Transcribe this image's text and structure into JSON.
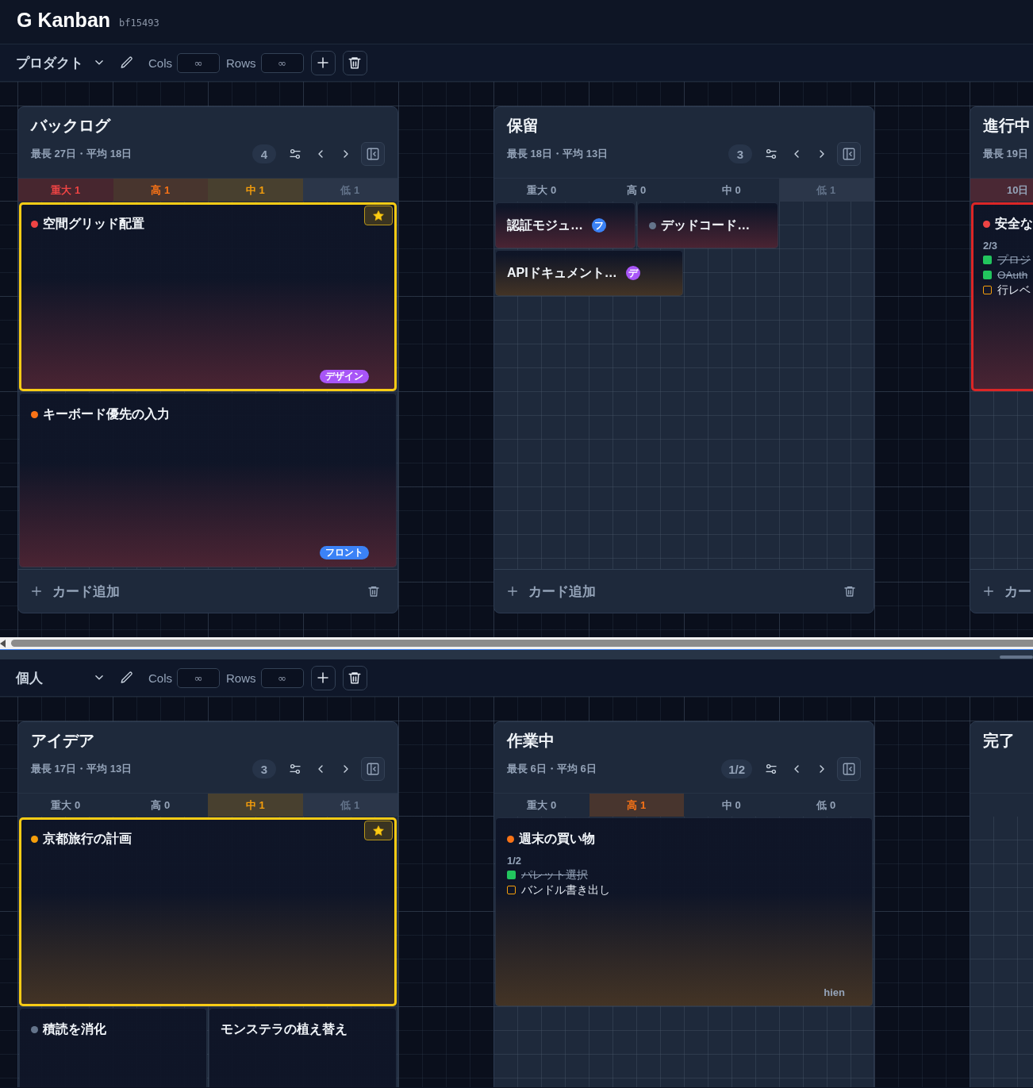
{
  "header": {
    "title": "G Kanban",
    "version": "bf15493"
  },
  "boards": [
    {
      "project": "プロダクト",
      "cols": {
        "label": "Cols",
        "placeholder": "∞"
      },
      "rows": {
        "label": "Rows",
        "placeholder": "∞"
      },
      "columns": [
        {
          "title": "バックログ",
          "stats": "最長 27日・平均 18日",
          "count": "4",
          "bands": [
            {
              "label": "重大 1",
              "kind": "critical",
              "active": true
            },
            {
              "label": "高 1",
              "kind": "high",
              "active": true
            },
            {
              "label": "中 1",
              "kind": "medium",
              "active": true
            },
            {
              "label": "低 1",
              "kind": "low",
              "active": true
            }
          ],
          "cards": [
            {
              "title": "空間グリッド配置",
              "color": "#ef4444",
              "kind": "red",
              "starred": true,
              "flagged": false,
              "tags": [
                {
                  "label": "デザイン",
                  "kind": "pill",
                  "color": "#a855f7"
                }
              ]
            },
            {
              "title": "キーボード優先の入力",
              "color": "#f97316",
              "kind": "red",
              "starred": false,
              "flagged": false,
              "tags": [
                {
                  "label": "フロント",
                  "kind": "pill",
                  "color": "#3b82f6"
                }
              ]
            }
          ],
          "footer": "カード追加"
        },
        {
          "title": "保留",
          "stats": "最長 18日・平均 13日",
          "count": "3",
          "bands": [
            {
              "label": "重大 0",
              "kind": "critical",
              "active": false
            },
            {
              "label": "高 0",
              "kind": "high",
              "active": false
            },
            {
              "label": "中 0",
              "kind": "medium",
              "active": false
            },
            {
              "label": "低 1",
              "kind": "low",
              "active": true
            }
          ],
          "cards": [
            {
              "title": "認証モジュ…",
              "kind": "red",
              "starred": false,
              "flagged": false,
              "tags": [
                {
                  "label": "フ",
                  "kind": "initial",
                  "color": "#3b82f6"
                }
              ]
            },
            {
              "title": "デッドコード…",
              "color": "#64748b",
              "kind": "red",
              "starred": false,
              "flagged": false
            },
            {
              "title": "APIドキュメント…",
              "kind": "amber",
              "starred": false,
              "flagged": false,
              "tags": [
                {
                  "label": "デ",
                  "kind": "initial",
                  "color": "#a855f7"
                }
              ]
            }
          ],
          "footer": "カード追加"
        },
        {
          "title": "進行中",
          "stats": "最長 19日",
          "bands": [
            {
              "label": "10日",
              "kind": "age",
              "active": true
            }
          ],
          "cards": [
            {
              "title": "安全な",
              "color": "#ef4444",
              "kind": "red",
              "starred": false,
              "flagged": true,
              "progress": "2/3",
              "checklist": [
                {
                  "text": "プロジ",
                  "checked": true
                },
                {
                  "text": "OAuth",
                  "checked": true
                },
                {
                  "text": "行レベ",
                  "checked": false
                }
              ]
            }
          ],
          "footer": "カー"
        }
      ]
    },
    {
      "project": "個人",
      "cols": {
        "label": "Cols",
        "placeholder": "∞"
      },
      "rows": {
        "label": "Rows",
        "placeholder": "∞"
      },
      "columns": [
        {
          "title": "アイデア",
          "stats": "最長 17日・平均 13日",
          "count": "3",
          "bands": [
            {
              "label": "重大 0",
              "kind": "critical",
              "active": false
            },
            {
              "label": "高 0",
              "kind": "high",
              "active": false
            },
            {
              "label": "中 1",
              "kind": "medium",
              "active": true
            },
            {
              "label": "低 1",
              "kind": "low",
              "active": true
            }
          ],
          "cards": [
            {
              "title": "京都旅行の計画",
              "color": "#f59e0b",
              "kind": "amber",
              "starred": true,
              "flagged": false
            },
            {
              "title": "積読を消化",
              "color": "#64748b",
              "kind": "red",
              "starred": false,
              "flagged": false
            },
            {
              "title": "モンステラの植え替え",
              "kind": "red",
              "starred": false,
              "flagged": false
            }
          ]
        },
        {
          "title": "作業中",
          "stats": "最長 6日・平均 6日",
          "count": "1/2",
          "bands": [
            {
              "label": "重大 0",
              "kind": "critical",
              "active": false
            },
            {
              "label": "高 1",
              "kind": "high",
              "active": true
            },
            {
              "label": "中 0",
              "kind": "medium",
              "active": false
            },
            {
              "label": "低 0",
              "kind": "low",
              "active": false
            }
          ],
          "cards": [
            {
              "title": "週末の買い物",
              "color": "#f97316",
              "kind": "amber",
              "starred": false,
              "flagged": false,
              "progress": "1/2",
              "checklist": [
                {
                  "text": "パレット選択",
                  "checked": true
                },
                {
                  "text": "バンドル書き出し",
                  "checked": false
                }
              ],
              "assignee": "hien"
            }
          ]
        },
        {
          "title": "完了"
        }
      ]
    }
  ]
}
